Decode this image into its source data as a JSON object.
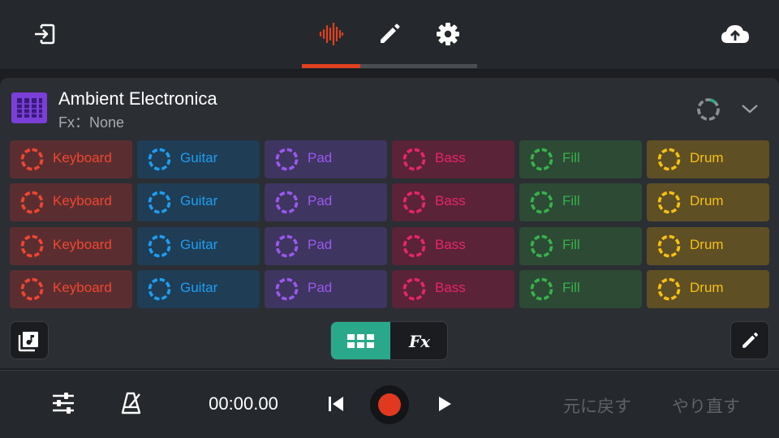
{
  "colors": {
    "accent_tab": "#e0411f",
    "toggle_active": "#2aa98a",
    "record": "#e0391f",
    "header_icon": "#7a3fd8"
  },
  "topbar": {
    "exit_icon": "exit-icon",
    "tabs": [
      {
        "icon": "waveform-icon",
        "active": true
      },
      {
        "icon": "pencil-icon",
        "active": false
      },
      {
        "icon": "gear-icon",
        "active": false
      }
    ],
    "cloud_icon": "cloud-upload-icon"
  },
  "song": {
    "title": "Ambient Electronica",
    "fx_label": "Fx：None"
  },
  "pad_columns": [
    {
      "label": "Keyboard",
      "color": "#f2452f",
      "bg": "#5a2e30"
    },
    {
      "label": "Guitar",
      "color": "#1e9ef2",
      "bg": "#1f3d55"
    },
    {
      "label": "Pad",
      "color": "#9b58f0",
      "bg": "#3e3560"
    },
    {
      "label": "Bass",
      "color": "#e8256a",
      "bg": "#5a2337"
    },
    {
      "label": "Fill",
      "color": "#36b34a",
      "bg": "#2d4a35"
    },
    {
      "label": "Drum",
      "color": "#f6c013",
      "bg": "#5e4f24"
    }
  ],
  "pad_rows": 4,
  "pads": {
    "r0": [
      "Keyboard",
      "Guitar",
      "Pad",
      "Bass",
      "Fill",
      "Drum"
    ],
    "r1": [
      "Keyboard",
      "Guitar",
      "Pad",
      "Bass",
      "Fill",
      "Drum"
    ],
    "r2": [
      "Keyboard",
      "Guitar",
      "Pad",
      "Bass",
      "Fill",
      "Drum"
    ],
    "r3": [
      "Keyboard",
      "Guitar",
      "Pad",
      "Bass",
      "Fill",
      "Drum"
    ]
  },
  "toggle": {
    "grid_icon": "grid-view-icon",
    "fx_label": "Fx",
    "active": "grid"
  },
  "transport": {
    "time": "00:00.00",
    "undo_label": "元に戻す",
    "redo_label": "やり直す"
  }
}
